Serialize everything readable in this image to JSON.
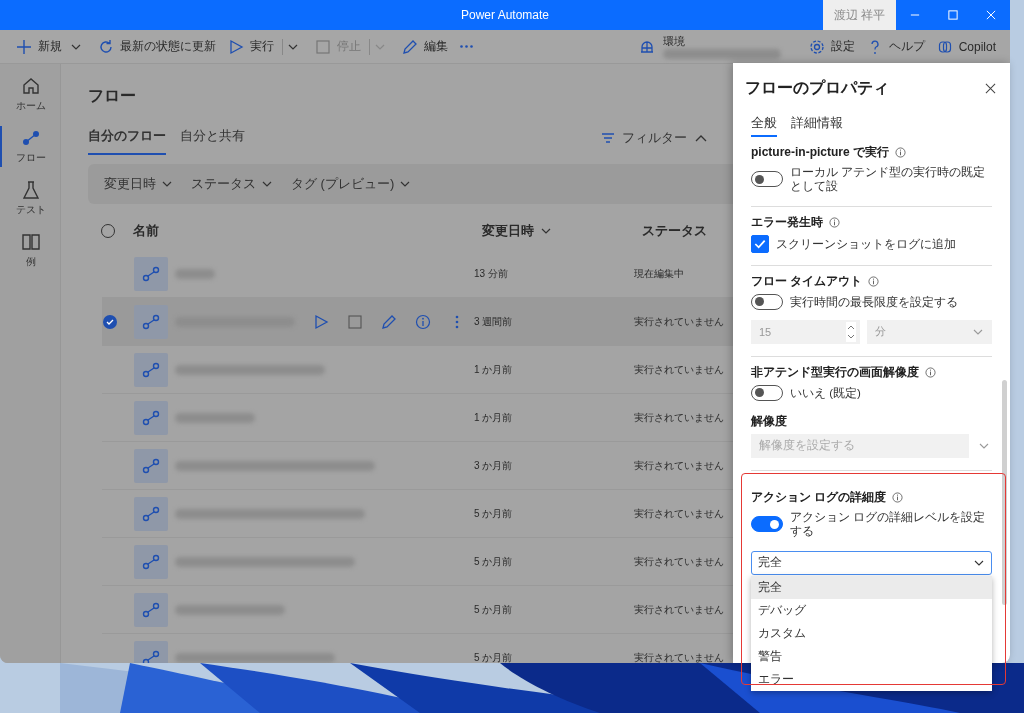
{
  "window": {
    "title": "Power Automate",
    "user": "渡辺 祥平"
  },
  "toolbar": {
    "items": [
      {
        "kind": "new",
        "label": "新規",
        "caret": true,
        "disabled": false
      },
      {
        "kind": "refresh",
        "label": "最新の状態に更新",
        "disabled": false
      },
      {
        "kind": "run",
        "label": "実行",
        "caret": true,
        "disabled": false
      },
      {
        "kind": "stop",
        "label": "停止",
        "caret": true,
        "disabled": true
      },
      {
        "kind": "edit",
        "label": "編集",
        "disabled": false
      },
      {
        "kind": "more",
        "disabled": false
      }
    ],
    "environment_label": "環境",
    "right": [
      {
        "kind": "settings",
        "label": "設定"
      },
      {
        "kind": "help",
        "label": "ヘルプ"
      },
      {
        "kind": "copilot",
        "label": "Copilot"
      }
    ]
  },
  "sidebar": {
    "items": [
      {
        "kind": "home",
        "label": "ホーム",
        "selected": false
      },
      {
        "kind": "flows",
        "label": "フロー",
        "selected": true
      },
      {
        "kind": "test",
        "label": "テスト",
        "selected": false
      },
      {
        "kind": "examples",
        "label": "例",
        "selected": false
      }
    ]
  },
  "page": {
    "title": "フロー",
    "tabs": [
      {
        "label": "自分のフロー",
        "selected": true
      },
      {
        "label": "自分と共有",
        "selected": false
      }
    ],
    "filter_button": "フィルター",
    "filters": [
      "変更日時",
      "ステータス",
      "タグ (プレビュー)"
    ]
  },
  "table": {
    "all_selected": false,
    "columns": [
      {
        "label": "名前",
        "sorted": false
      },
      {
        "label": "変更日時",
        "sorted": true
      },
      {
        "label": "ステータス",
        "sorted": false
      }
    ],
    "rows": [
      {
        "modified": "13 分前",
        "status": "現在編集中",
        "selected": false
      },
      {
        "modified": "3 週間前",
        "status": "実行されていません",
        "selected": true
      },
      {
        "modified": "1 か月前",
        "status": "実行されていません",
        "selected": false
      },
      {
        "modified": "1 か月前",
        "status": "実行されていません",
        "selected": false
      },
      {
        "modified": "3 か月前",
        "status": "実行されていません",
        "selected": false
      },
      {
        "modified": "5 か月前",
        "status": "実行されていません",
        "selected": false
      },
      {
        "modified": "5 か月前",
        "status": "実行されていません",
        "selected": false
      },
      {
        "modified": "5 か月前",
        "status": "実行されていません",
        "selected": false
      },
      {
        "modified": "5 か月前",
        "status": "実行されていません",
        "selected": false
      }
    ]
  },
  "panel": {
    "title": "フローのプロパティ",
    "tabs": [
      {
        "label": "全般",
        "selected": true
      },
      {
        "label": "詳細情報",
        "selected": false
      }
    ],
    "sections": [
      {
        "heading": "picture-in-picture で実行",
        "controls": [
          {
            "kind": "toggle",
            "label": "ローカル アテンド型の実行時の既定として設",
            "on": false
          }
        ]
      },
      {
        "heading": "エラー発生時",
        "controls": [
          {
            "kind": "checkbox",
            "label": "スクリーンショットをログに追加",
            "checked": true
          }
        ]
      },
      {
        "heading": "フロー タイムアウト",
        "controls": [
          {
            "kind": "toggle",
            "label": "実行時間の最長限度を設定する",
            "on": false
          },
          {
            "kind": "number_unit",
            "value": "15",
            "unit": "分",
            "disabled": true
          }
        ]
      },
      {
        "heading": "非アテンド型実行の画面解像度",
        "controls": [
          {
            "kind": "toggle",
            "label": "いいえ (既定)",
            "on": false
          },
          {
            "kind": "label",
            "label": "解像度"
          },
          {
            "kind": "select",
            "placeholder": "解像度を設定する",
            "disabled": true
          }
        ]
      },
      {
        "heading": "アクション ログの詳細度",
        "highlighted": true,
        "controls": [
          {
            "kind": "toggle",
            "label": "アクション ログの詳細レベルを設定する",
            "on": true
          },
          {
            "kind": "dropdown",
            "value": "完全",
            "expanded": true,
            "options": [
              {
                "label": "完全",
                "selected": true
              },
              {
                "label": "デバッグ",
                "selected": false
              },
              {
                "label": "カスタム",
                "selected": false
              },
              {
                "label": "警告",
                "selected": false
              },
              {
                "label": "エラー",
                "selected": false
              }
            ]
          }
        ]
      }
    ]
  }
}
